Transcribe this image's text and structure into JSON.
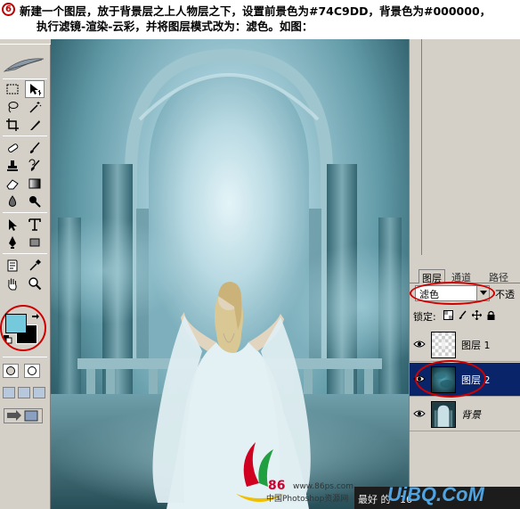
{
  "instruction": {
    "step_number": "6",
    "line1": "新建一个图层，放于背景层之上人物层之下，设置前景色为#74C9DD，背景色为#000000，",
    "line2": "执行滤镜-渲染-云彩，并将图层模式改为：滤色。如图："
  },
  "colors": {
    "foreground": "#74C9DD",
    "background": "#000000",
    "highlight_circle": "#d00000",
    "selected_layer": "#0a246a"
  },
  "toolbox": {
    "tools": [
      "marquee-tool",
      "move-tool",
      "lasso-tool",
      "magic-wand-tool",
      "crop-tool",
      "slice-tool",
      "healing-brush-tool",
      "brush-tool",
      "clone-stamp-tool",
      "history-brush-tool",
      "eraser-tool",
      "gradient-tool",
      "blur-tool",
      "dodge-tool",
      "path-selection-tool",
      "type-tool",
      "pen-tool",
      "shape-tool",
      "notes-tool",
      "eyedropper-tool",
      "hand-tool",
      "zoom-tool"
    ]
  },
  "layers_panel": {
    "tabs": [
      "图层",
      "通道",
      "路径"
    ],
    "blend_mode": "滤色",
    "opacity_label": "不透",
    "lock_label": "锁定:",
    "layers": [
      {
        "name": "图层 1",
        "visible": true,
        "selected": false
      },
      {
        "name": "图层 2",
        "visible": true,
        "selected": true
      },
      {
        "name": "背景",
        "visible": true,
        "selected": false
      }
    ]
  },
  "watermark": {
    "site_number": "86",
    "url": "www.86ps.com",
    "site_name": "中国Photoshop资源网",
    "brand": "UiBQ.CoM"
  },
  "status": {
    "text": "最好 的 · 16"
  }
}
